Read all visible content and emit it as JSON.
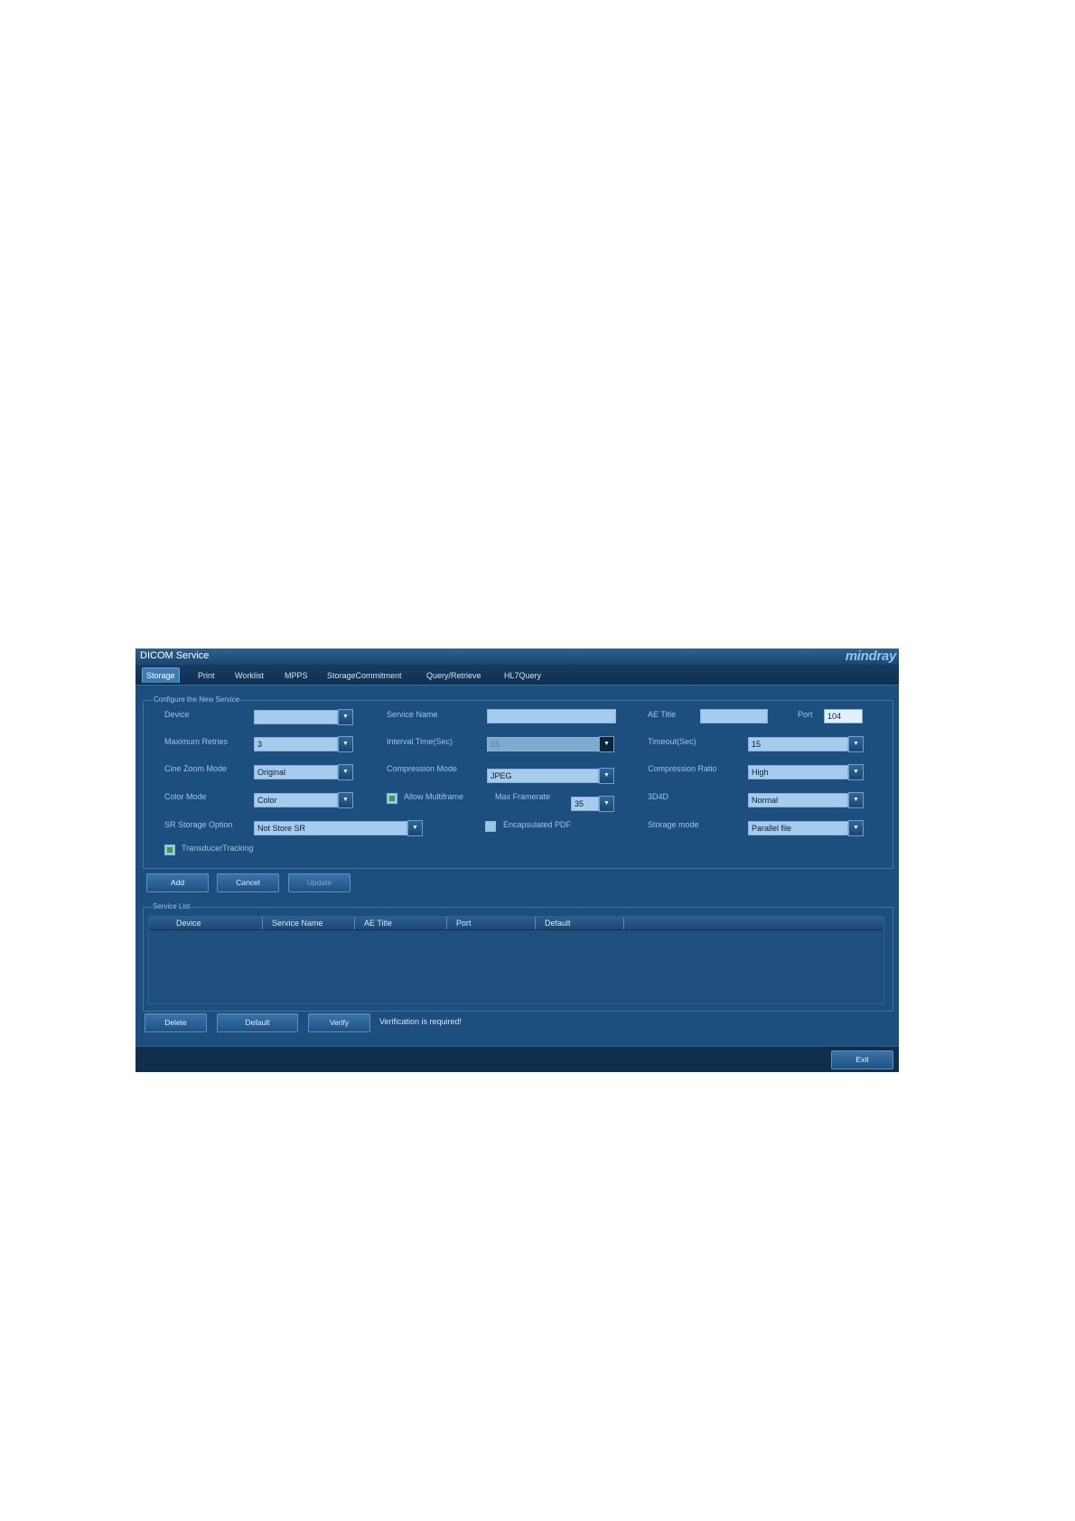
{
  "window": {
    "title": "DICOM Service",
    "brand": "mindray"
  },
  "tabs": [
    "Storage",
    "Print",
    "Worklist",
    "MPPS",
    "StorageCommitment",
    "Query/Retrieve",
    "HL7Query"
  ],
  "config": {
    "group_title": "Configure the New Service",
    "device": {
      "label": "Device",
      "value": ""
    },
    "service_name": {
      "label": "Service Name",
      "value": ""
    },
    "ae_title": {
      "label": "AE Title",
      "value": ""
    },
    "port": {
      "label": "Port",
      "value": "104"
    },
    "maximum_retries": {
      "label": "Maximum Retries",
      "value": "3"
    },
    "interval_time": {
      "label": "Interval Time(Sec)",
      "value": "15"
    },
    "timeout": {
      "label": "Timeout(Sec)",
      "value": "15"
    },
    "cine_zoom_mode": {
      "label": "Cine Zoom Mode",
      "value": "Original"
    },
    "compression_mode": {
      "label": "Compression Mode",
      "value": "JPEG"
    },
    "compression_ratio": {
      "label": "Compression Ratio",
      "value": "High"
    },
    "color_mode": {
      "label": "Color Mode",
      "value": "Color"
    },
    "allow_multiframe": {
      "label": "Allow Multiframe",
      "checked": true
    },
    "max_framerate": {
      "label": "Max Framerate",
      "value": "35"
    },
    "mode_3d4d": {
      "label": "3D4D",
      "value": "Normal"
    },
    "sr_storage_option": {
      "label": "SR Storage Option",
      "value": "Not Store SR"
    },
    "encapsulated_pdf": {
      "label": "Encapsulated PDF",
      "checked": false
    },
    "storage_mode": {
      "label": "Storage mode",
      "value": "Parallel file"
    },
    "transducer_tracking": {
      "label": "TransducerTracking",
      "checked": true
    }
  },
  "actions": {
    "add": "Add",
    "cancel": "Cancel",
    "update": "Update"
  },
  "service_list": {
    "group_title": "Service List",
    "columns": [
      "Device",
      "Service Name",
      "AE Title",
      "Port",
      "Default"
    ],
    "rows": []
  },
  "bottom": {
    "delete": "Delete",
    "default": "Default",
    "verify": "Verify",
    "status": "Verification is required!",
    "exit": "Exit"
  },
  "colors": {
    "window_bg": "#1d4f7e",
    "field_bg": "#a6cbec",
    "checked": "#2fa33c"
  }
}
